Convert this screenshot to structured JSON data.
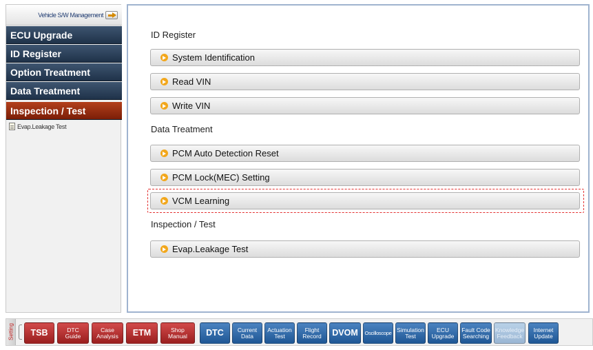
{
  "sidebar": {
    "header_label": "Vehicle S/W Management",
    "menu": [
      {
        "label": "ECU Upgrade"
      },
      {
        "label": "ID Register"
      },
      {
        "label": "Option Treatment"
      },
      {
        "label": "Data Treatment"
      },
      {
        "label": "Inspection / Test"
      }
    ],
    "sub_item": "Evap.Leakage Test"
  },
  "main": {
    "sections": [
      {
        "title": "ID Register",
        "items": [
          "System Identification",
          "Read VIN",
          "Write VIN"
        ]
      },
      {
        "title": "Data Treatment",
        "items": [
          "PCM Auto Detection Reset",
          "PCM Lock(MEC) Setting",
          "VCM Learning"
        ]
      },
      {
        "title": "Inspection / Test",
        "items": [
          "Evap.Leakage Test"
        ]
      }
    ]
  },
  "toolbar": {
    "setting_label": "Setting",
    "buttons": [
      {
        "label": "TSB"
      },
      {
        "label": "DTC\nGuide"
      },
      {
        "label": "Case\nAnalysis"
      },
      {
        "label": "ETM"
      },
      {
        "label": "Shop\nManual"
      },
      {
        "label": "DTC"
      },
      {
        "label": "Current\nData"
      },
      {
        "label": "Actuation\nTest"
      },
      {
        "label": "Flight\nRecord"
      },
      {
        "label": "DVOM"
      },
      {
        "label": "Oscilloscope"
      },
      {
        "label": "Simulation\nTest"
      },
      {
        "label": "ECU\nUpgrade"
      },
      {
        "label": "Fault Code\nSearching"
      },
      {
        "label": "Knowledge\nFeedback"
      },
      {
        "label": "Internet\nUpdate"
      }
    ]
  },
  "colors": {
    "menu_normal": "#1f3249",
    "menu_active": "#9a2b0f",
    "toolbar_red": "#b53030",
    "toolbar_blue": "#2d67a8",
    "highlight_border": "#e33030",
    "bullet": "#f2a71c"
  }
}
